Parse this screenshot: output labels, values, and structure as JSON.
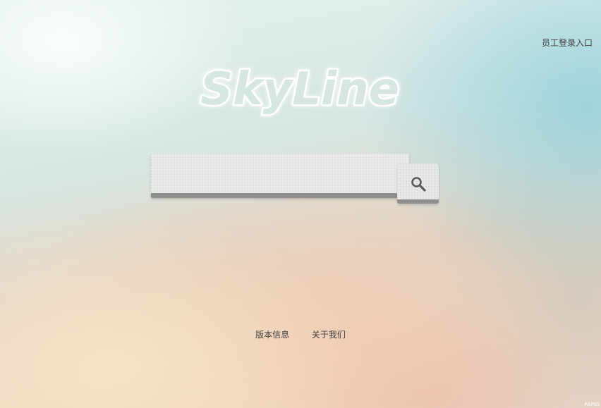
{
  "header": {
    "staff_login_label": "员工登录入口"
  },
  "logo": {
    "text": "SkyLine",
    "fill_color": "#d6e6e3",
    "outline_color": "#ffffff"
  },
  "search": {
    "value": "",
    "placeholder": "",
    "button_icon": "search-icon"
  },
  "footer": {
    "links": [
      {
        "label": "版本信息"
      },
      {
        "label": "关于我们"
      }
    ]
  },
  "watermark": {
    "text": "RAPOS"
  },
  "colors": {
    "text": "#3d3d3d",
    "input_bg": "#ebebeb",
    "input_shadow": "#8f8f8f"
  }
}
